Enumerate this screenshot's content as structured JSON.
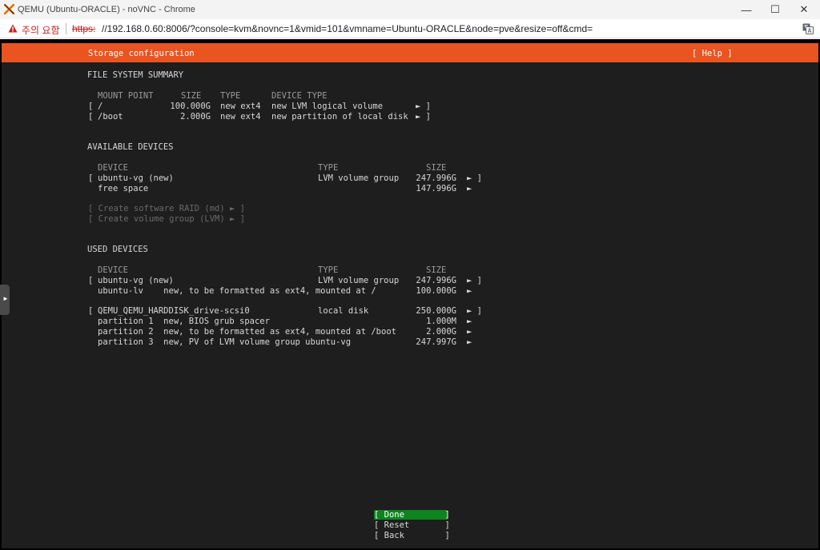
{
  "window": {
    "title": "QEMU (Ubuntu-ORACLE) - noVNC - Chrome",
    "min_glyph": "—",
    "max_glyph": "☐",
    "close_glyph": "✕"
  },
  "address_bar": {
    "warning": "주의 요함",
    "url_scheme": "https:",
    "url_rest": "//192.168.0.60:8006/?console=kvm&novnc=1&vmid=101&vmname=Ubuntu-ORACLE&node=pve&resize=off&cmd="
  },
  "installer": {
    "header_title": "Storage configuration",
    "help": "[ Help ]",
    "fs_summary": {
      "heading": "FILE SYSTEM SUMMARY",
      "columns": {
        "mount": "MOUNT POINT",
        "size": "SIZE",
        "type": "TYPE",
        "device_type": "DEVICE TYPE"
      },
      "rows": [
        {
          "open": "[",
          "mount": "/",
          "size": "100.000G",
          "type": "new ext4",
          "device_type": "new LVM logical volume",
          "arrow": "► ]"
        },
        {
          "open": "[",
          "mount": "/boot",
          "size": "2.000G",
          "type": "new ext4",
          "device_type": "new partition of local disk",
          "arrow": "► ]"
        }
      ]
    },
    "available": {
      "heading": "AVAILABLE DEVICES",
      "columns": {
        "device": "DEVICE",
        "type": "TYPE",
        "size": "SIZE"
      },
      "rows": [
        {
          "open": "[",
          "device": "ubuntu-vg (new)",
          "type": "LVM volume group",
          "size": "247.996G",
          "arrow": "► ]"
        },
        {
          "open": "",
          "device": "free space",
          "type": "",
          "size": "147.996G",
          "arrow": "►"
        }
      ],
      "actions": [
        "[ Create software RAID (md) ► ]",
        "[ Create volume group (LVM) ► ]"
      ]
    },
    "used": {
      "heading": "USED DEVICES",
      "columns": {
        "device": "DEVICE",
        "type": "TYPE",
        "size": "SIZE"
      },
      "rows": [
        {
          "open": "[",
          "device": "ubuntu-vg (new)",
          "type": "LVM volume group",
          "size": "247.996G",
          "arrow": "► ]"
        },
        {
          "open": "",
          "device": "ubuntu-lv    new, to be formatted as ext4, mounted at /",
          "type": "",
          "size": "100.000G",
          "arrow": "►"
        },
        {
          "open": "[",
          "device": "QEMU_QEMU_HARDDISK_drive-scsi0",
          "type": "local disk",
          "size": "250.000G",
          "arrow": "► ]"
        },
        {
          "open": "",
          "device": "partition 1  new, BIOS grub spacer",
          "type": "",
          "size": "1.000M",
          "arrow": "►"
        },
        {
          "open": "",
          "device": "partition 2  new, to be formatted as ext4, mounted at /boot",
          "type": "",
          "size": "2.000G",
          "arrow": "►"
        },
        {
          "open": "",
          "device": "partition 3  new, PV of LVM volume group ubuntu-vg",
          "type": "",
          "size": "247.997G",
          "arrow": "►"
        }
      ]
    },
    "buttons": {
      "done": "[ Done        ]",
      "reset": "[ Reset       ]",
      "back": "[ Back        ]"
    },
    "side_tab_glyph": "►"
  }
}
